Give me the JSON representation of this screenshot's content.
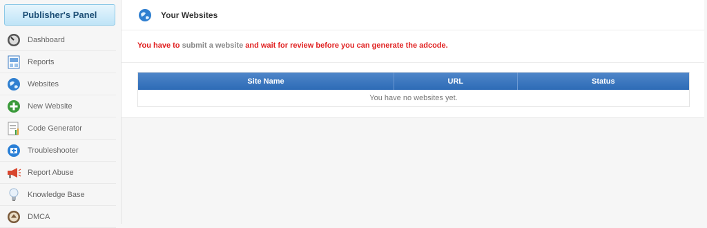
{
  "sidebar": {
    "title": "Publisher's Panel",
    "items": [
      {
        "label": "Dashboard",
        "icon": "dashboard-gauge-icon"
      },
      {
        "label": "Reports",
        "icon": "reports-chart-icon"
      },
      {
        "label": "Websites",
        "icon": "globe-icon"
      },
      {
        "label": "New Website",
        "icon": "plus-circle-icon"
      },
      {
        "label": "Code Generator",
        "icon": "code-document-icon"
      },
      {
        "label": "Troubleshooter",
        "icon": "first-aid-icon"
      },
      {
        "label": "Report Abuse",
        "icon": "megaphone-icon"
      },
      {
        "label": "Knowledge Base",
        "icon": "lightbulb-icon"
      },
      {
        "label": "DMCA",
        "icon": "seal-icon"
      }
    ]
  },
  "main": {
    "header_title": "Your Websites",
    "notice": {
      "prefix": "You have to ",
      "link": "submit a website",
      "suffix": " and wait for review before you can generate the adcode."
    },
    "table": {
      "columns": [
        "Site Name",
        "URL",
        "Status"
      ],
      "empty_text": "You have no websites yet."
    }
  },
  "colors": {
    "table_header": "#2d6bb6",
    "notice_red": "#e02020",
    "panel_title_bg": "#bfe4f7"
  }
}
